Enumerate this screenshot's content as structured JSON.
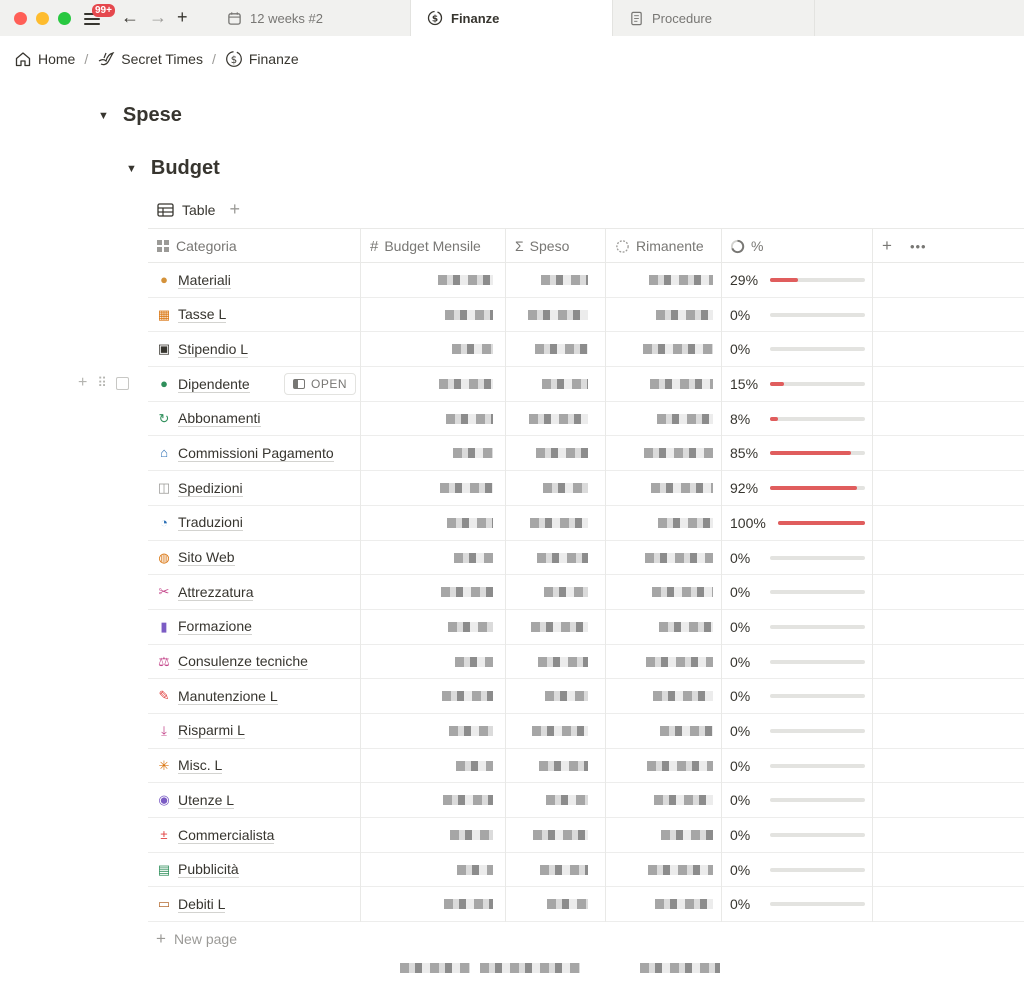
{
  "titlebar": {
    "badge": "99+",
    "tabs": [
      {
        "label": "12 weeks #2",
        "icon": "calendar-icon"
      },
      {
        "label": "Finanze",
        "icon": "dollar-circle-icon"
      },
      {
        "label": "Procedure",
        "icon": "document-icon"
      }
    ]
  },
  "breadcrumb": {
    "items": [
      {
        "label": "Home",
        "icon": "home-icon"
      },
      {
        "label": "Secret Times",
        "icon": "bird-icon"
      },
      {
        "label": "Finanze",
        "icon": "dollar-circle-icon"
      }
    ]
  },
  "headings": {
    "spese": "Spese",
    "budget": "Budget"
  },
  "view": {
    "label": "Table"
  },
  "table": {
    "columns": [
      {
        "label": "Categoria",
        "icon": "title-icon"
      },
      {
        "label": "Budget Mensile",
        "icon": "hash-icon"
      },
      {
        "label": "Speso",
        "icon": "sigma-icon"
      },
      {
        "label": "Rimanente",
        "icon": "formula-icon"
      },
      {
        "label": "%",
        "icon": "progress-icon"
      }
    ],
    "rows": [
      {
        "name": "Materiali",
        "icon": "cookie-icon",
        "percent_label": "29%",
        "percent": 29
      },
      {
        "name": "Tasse L",
        "icon": "receipt-icon",
        "percent_label": "0%",
        "percent": 0
      },
      {
        "name": "Stipendio L",
        "icon": "cash-icon",
        "percent_label": "0%",
        "percent": 0
      },
      {
        "name": "Dipendente",
        "icon": "person-icon",
        "percent_label": "15%",
        "percent": 15
      },
      {
        "name": "Abbonamenti",
        "icon": "refresh-icon",
        "percent_label": "8%",
        "percent": 8
      },
      {
        "name": "Commissioni Pagamento",
        "icon": "bank-icon",
        "percent_label": "85%",
        "percent": 85
      },
      {
        "name": "Spedizioni",
        "icon": "box-icon",
        "percent_label": "92%",
        "percent": 92
      },
      {
        "name": "Traduzioni",
        "icon": "translate-icon",
        "percent_label": "100%",
        "percent": 100
      },
      {
        "name": "Sito Web",
        "icon": "globe-icon",
        "percent_label": "0%",
        "percent": 0
      },
      {
        "name": "Attrezzatura",
        "icon": "scissors-icon",
        "percent_label": "0%",
        "percent": 0
      },
      {
        "name": "Formazione",
        "icon": "book-icon",
        "percent_label": "0%",
        "percent": 0
      },
      {
        "name": "Consulenze tecniche",
        "icon": "scale-icon",
        "percent_label": "0%",
        "percent": 0
      },
      {
        "name": "Manutenzione L",
        "icon": "wrench-icon",
        "percent_label": "0%",
        "percent": 0
      },
      {
        "name": "Risparmi L",
        "icon": "download-icon",
        "percent_label": "0%",
        "percent": 0
      },
      {
        "name": "Misc. L",
        "icon": "asterisk-icon",
        "percent_label": "0%",
        "percent": 0
      },
      {
        "name": "Utenze L",
        "icon": "lightbulb-icon",
        "percent_label": "0%",
        "percent": 0
      },
      {
        "name": "Commercialista",
        "icon": "calculator-icon",
        "percent_label": "0%",
        "percent": 0
      },
      {
        "name": "Pubblicità",
        "icon": "billboard-icon",
        "percent_label": "0%",
        "percent": 0
      },
      {
        "name": "Debiti L",
        "icon": "ticket-icon",
        "percent_label": "0%",
        "percent": 0
      }
    ],
    "open_label": "OPEN",
    "new_page": "New page"
  },
  "colors": {
    "accent": "#e05d5d",
    "track": "#e3e3e0"
  }
}
